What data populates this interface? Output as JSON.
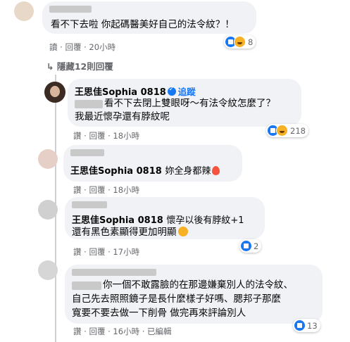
{
  "comment1": {
    "text": "看不下去啦 你起碼醫美好自己的法令紋？！",
    "reply_label": "讀 · 回覆 · 20小時",
    "reaction_count": "8",
    "reaction_icons": [
      "like-icon",
      "haha-icon"
    ]
  },
  "hidden_replies": {
    "label": "隱藏12則回覆"
  },
  "reply1": {
    "author": "王思佳Sophia 0818",
    "follow_label": "追蹤",
    "line1": "看不下去閉上雙眼呀～有法令紋怎麼了？",
    "line2": "我最近懷孕還有脖紋呢",
    "meta": "讚 · 回覆 · 18小時",
    "reaction_count": "218",
    "reaction_icons": [
      "like-icon",
      "haha-icon"
    ]
  },
  "reply2": {
    "author": "王思佳Sophia 0818",
    "text": "妳全身都辣",
    "emoji": "fire-emoji",
    "meta": "讚 · 回覆 · 18小時"
  },
  "reply3": {
    "author": "王思佳Sophia 0818",
    "text": "懷孕以後有脖紋+1",
    "line2": "還有黑色素顯得更加明顯",
    "emoji": "crying-face-emoji",
    "meta": "讚 · 回覆 · 17小時",
    "reaction_count": "2",
    "reaction_icons": [
      "like-icon"
    ]
  },
  "reply4": {
    "line1": "你一個不敢露臉的在那邊嫌棄別人的法令紋、",
    "line2": "自己先去照照鏡子是長什麼樣子好嗎、腮邦子那麼",
    "line3": "寬要不要去做一下削骨 做完再來評論別人",
    "meta": "讚 · 回覆 · 16小時 · 已編輯",
    "reaction_count": "13",
    "reaction_icons": [
      "like-icon"
    ]
  },
  "colors": {
    "accent": "#1877f2",
    "bubble": "#f0f2f5",
    "meta": "#65676b"
  }
}
